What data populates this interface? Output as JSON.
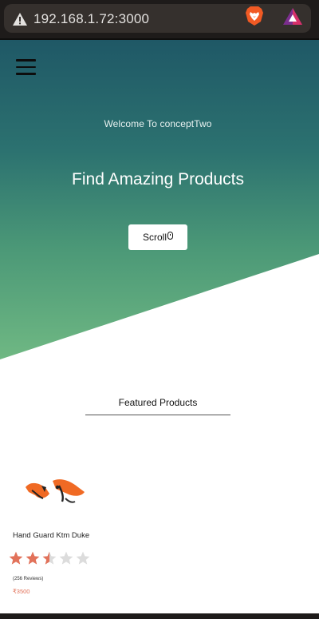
{
  "browser": {
    "url": "192.168.1.72:3000",
    "warning_icon": "warning-triangle-icon",
    "brave_icon": "brave-lion-icon",
    "rewards_icon": "brave-rewards-icon"
  },
  "header": {
    "menu_icon": "hamburger-menu-icon"
  },
  "hero": {
    "welcome": "Welcome To conceptTwo",
    "heading": "Find Amazing Products",
    "scroll_label": "Scroll",
    "scroll_icon": "mouse-icon",
    "gradient_colors": [
      "#1f5866",
      "#2c7270",
      "#4b9877",
      "#6fb883"
    ]
  },
  "featured": {
    "title": "Featured Products",
    "products": [
      {
        "name": "Hand Guard Ktm Duke",
        "rating": 2.5,
        "max_rating": 5,
        "reviews": "(256 Reviews)",
        "price": "₹3500"
      }
    ]
  },
  "colors": {
    "star_filled": "#e2725a",
    "star_empty": "#dcdcdc",
    "price": "#e2725a"
  }
}
